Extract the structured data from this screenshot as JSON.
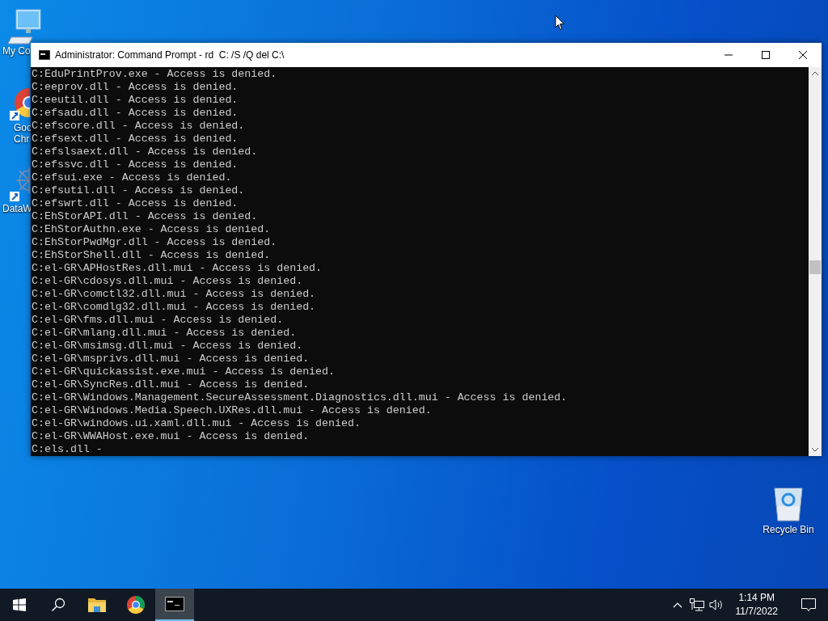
{
  "desktop_icons": [
    {
      "kind": "computer",
      "label_lines": [
        "My Co"
      ]
    },
    {
      "kind": "chrome",
      "label_lines": [
        "Goo",
        "Chr"
      ]
    },
    {
      "kind": "chart",
      "label_lines": [
        "DataW"
      ]
    }
  ],
  "recycle_bin": {
    "label": "Recycle Bin"
  },
  "window": {
    "title": "Administrator: Command Prompt - rd  C: /S /Q del C:\\",
    "lines": [
      "C:EduPrintProv.exe - Access is denied.",
      "C:eeprov.dll - Access is denied.",
      "C:eeutil.dll - Access is denied.",
      "C:efsadu.dll - Access is denied.",
      "C:efscore.dll - Access is denied.",
      "C:efsext.dll - Access is denied.",
      "C:efslsaext.dll - Access is denied.",
      "C:efssvc.dll - Access is denied.",
      "C:efsui.exe - Access is denied.",
      "C:efsutil.dll - Access is denied.",
      "C:efswrt.dll - Access is denied.",
      "C:EhStorAPI.dll - Access is denied.",
      "C:EhStorAuthn.exe - Access is denied.",
      "C:EhStorPwdMgr.dll - Access is denied.",
      "C:EhStorShell.dll - Access is denied.",
      "C:el-GR\\APHostRes.dll.mui - Access is denied.",
      "C:el-GR\\cdosys.dll.mui - Access is denied.",
      "C:el-GR\\comctl32.dll.mui - Access is denied.",
      "C:el-GR\\comdlg32.dll.mui - Access is denied.",
      "C:el-GR\\fms.dll.mui - Access is denied.",
      "C:el-GR\\mlang.dll.mui - Access is denied.",
      "C:el-GR\\msimsg.dll.mui - Access is denied.",
      "C:el-GR\\msprivs.dll.mui - Access is denied.",
      "C:el-GR\\quickassist.exe.mui - Access is denied.",
      "C:el-GR\\SyncRes.dll.mui - Access is denied.",
      "C:el-GR\\Windows.Management.SecureAssessment.Diagnostics.dll.mui - Access is denied.",
      "C:el-GR\\Windows.Media.Speech.UXRes.dll.mui - Access is denied.",
      "C:el-GR\\windows.ui.xaml.dll.mui - Access is denied.",
      "C:el-GR\\WWAHost.exe.mui - Access is denied.",
      "C:els.dll -"
    ]
  },
  "taskbar": {
    "apps": [
      {
        "kind": "start",
        "selected": false
      },
      {
        "kind": "search",
        "selected": false
      },
      {
        "kind": "folder",
        "selected": false
      },
      {
        "kind": "chrome",
        "selected": false
      },
      {
        "kind": "console",
        "selected": true
      }
    ],
    "tray": [
      {
        "kind": "chevron"
      },
      {
        "kind": "network"
      },
      {
        "kind": "volume"
      }
    ],
    "clock": {
      "time": "1:14 PM",
      "date": "11/7/2022"
    }
  }
}
